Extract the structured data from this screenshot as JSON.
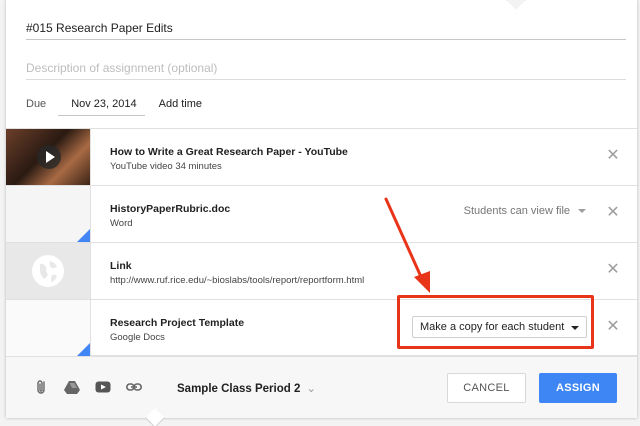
{
  "assignment": {
    "title": "#015 Research Paper Edits",
    "description_placeholder": "Description of assignment (optional)",
    "due_label": "Due",
    "due_date": "Nov 23, 2014",
    "add_time": "Add time"
  },
  "attachments": [
    {
      "title": "How to Write a Great Research Paper - YouTube",
      "subtitle": "YouTube video  34 minutes",
      "thumbnail": "video-thumbnail"
    },
    {
      "title": "HistoryPaperRubric.doc",
      "subtitle": "Word",
      "permission": "Students can view file",
      "thumbnail": "document-thumbnail"
    },
    {
      "title": "Link",
      "subtitle": "http://www.ruf.rice.edu/~bioslabs/tools/report/reportform.html",
      "thumbnail": "globe-icon"
    },
    {
      "title": "Research Project Template",
      "subtitle": "Google Docs",
      "permission": "Make a copy for each student",
      "thumbnail": "document-thumbnail"
    }
  ],
  "footer": {
    "class_name": "Sample Class Period 2",
    "cancel": "CANCEL",
    "assign": "ASSIGN",
    "icons": [
      "paperclip-icon",
      "drive-icon",
      "youtube-icon",
      "link-icon"
    ]
  },
  "colors": {
    "accent": "#3d86f4",
    "annotation": "#e8351a",
    "doc_corner": "#4285f4"
  }
}
